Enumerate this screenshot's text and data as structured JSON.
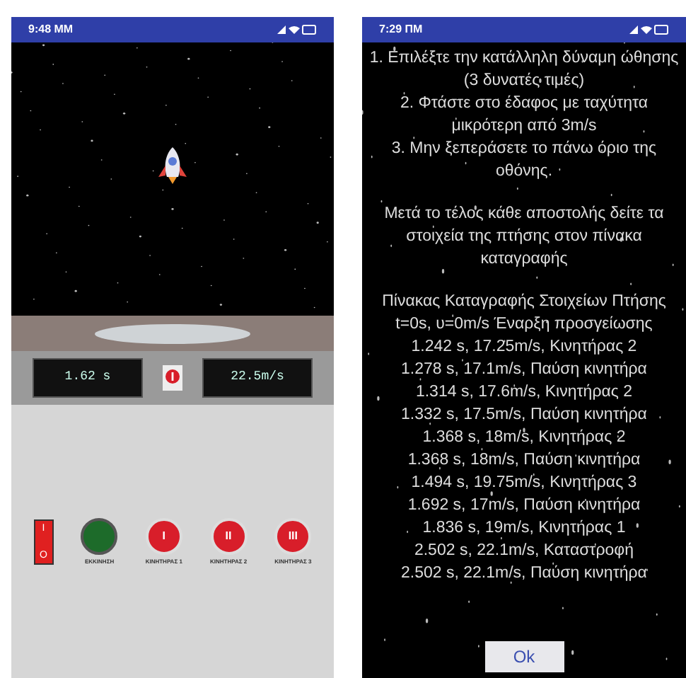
{
  "game_screen": {
    "status_bar": {
      "time": "9:48 MM"
    },
    "speed_display": {
      "time": "1.62 s",
      "speed": "22.5m/s"
    },
    "controls": [
      {
        "kind": "switch",
        "symbol_on": "I",
        "symbol_off": "O",
        "on": true
      },
      {
        "kind": "start",
        "caption": "ΕΚΚΙΝΗΣΗ"
      },
      {
        "kind": "engine",
        "symbol": "I",
        "caption": "ΚΙΝΗΤΗΡΑΣ 1"
      },
      {
        "kind": "engine",
        "symbol": "II",
        "caption": "ΚΙΝΗΤΗΡΑΣ 2"
      },
      {
        "kind": "engine",
        "symbol": "III",
        "caption": "ΚΙΝΗΤΗΡΑΣ 3"
      }
    ]
  },
  "results_screen": {
    "status_bar": {
      "time": "7:29 ΠΜ"
    },
    "instructions": [
      "1. Επιλέξτε την κατάλληλη δύναμη ώθησης (3 δυνατές τιμές)",
      "2. Φτάστε στο έδαφος με ταχύτητα μικρότερη από 3m/s",
      "3. Μην ξεπεράσετε το πάνω όριο της οθόνης."
    ],
    "note": "Μετά το τέλος κάθε αποστολής δείτε τα στοιχεία της πτήσης στον πίνακα καταγραφής",
    "log_title": "Πίνακας Καταγραφής Στοιχείων Πτήσης",
    "log": [
      "t=0s, υ=0m/s Έναρξη προσγείωσης",
      "1.242 s, 17.25m/s, Κινητήρας 2",
      "1.278 s, 17.1m/s, Παύση κινητήρα",
      "1.314 s, 17.6m/s, Κινητήρας 2",
      "1.332 s, 17.5m/s, Παύση κινητήρα",
      "1.368 s, 18m/s, Κινητήρας 2",
      "1.368 s, 18m/s, Παύση κινητήρα",
      "1.494 s, 19.75m/s, Κινητήρας 3",
      "1.692 s, 17m/s, Παύση κινητήρα",
      "1.836 s, 19m/s, Κινητήρας 1",
      "2.502 s, 22.1m/s, Καταστροφή",
      "2.502 s, 22.1m/s, Παύση κινητήρα"
    ],
    "ok_button": "Ok"
  }
}
